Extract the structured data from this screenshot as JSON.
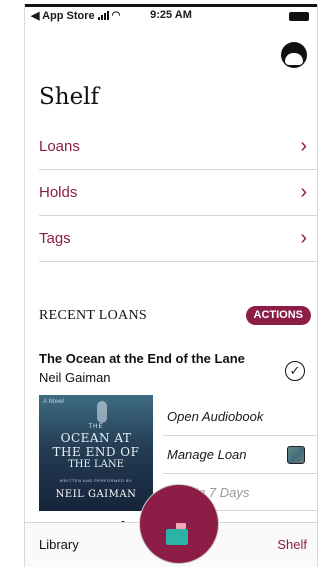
{
  "status_bar": {
    "back_app": "◀ App Store",
    "time": "9:25 AM"
  },
  "page": {
    "title": "Shelf"
  },
  "nav": [
    {
      "label": "Loans"
    },
    {
      "label": "Holds"
    },
    {
      "label": "Tags"
    }
  ],
  "recent_loans": {
    "heading": "RECENT LOANS",
    "actions_label": "ACTIONS"
  },
  "book": {
    "title": "The Ocean at the End of the Lane",
    "author": "Neil Gaiman",
    "cover": {
      "kicker": "A Novel",
      "the": "THE",
      "line1": "OCEAN AT",
      "line2": "THE END OF",
      "line3": "THE LANE",
      "small": "WRITTEN AND PERFORMED BY",
      "author": "NEIL GAIMAN"
    },
    "actions": {
      "open": "Open Audiobook",
      "manage": "Manage Loan",
      "due": "Due In 7 Days"
    }
  },
  "tab_bar": {
    "library": "Library",
    "shelf": "Shelf"
  },
  "colors": {
    "accent": "#8c1d47",
    "text": "#111111",
    "divider": "#d6d6d6"
  },
  "icons": [
    "account-icon",
    "chevron-right-icon",
    "check-circle-icon",
    "notebook-icon",
    "book-icon",
    "signal-icon",
    "wifi-icon",
    "battery-icon"
  ]
}
